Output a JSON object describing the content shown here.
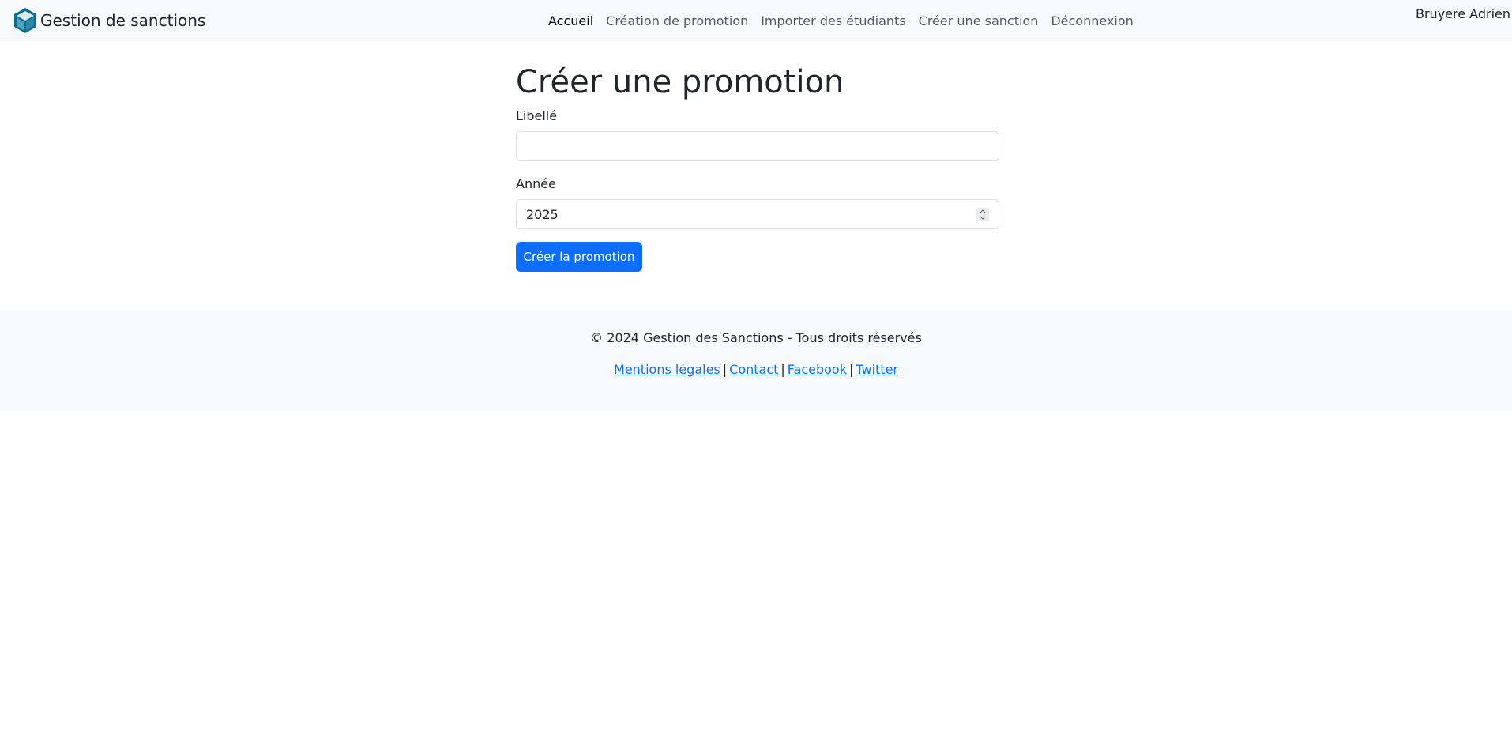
{
  "navbar": {
    "brand": "Gestion de sanctions",
    "links": [
      {
        "label": "Accueil",
        "active": true
      },
      {
        "label": "Création de promotion",
        "active": false
      },
      {
        "label": "Importer des étudiants",
        "active": false
      },
      {
        "label": "Créer une sanction",
        "active": false
      },
      {
        "label": "Déconnexion",
        "active": false
      }
    ],
    "user": "Bruyere Adrien"
  },
  "form": {
    "title": "Créer une promotion",
    "libelle_label": "Libellé",
    "libelle_value": "",
    "annee_label": "Année",
    "annee_value": "2025",
    "submit_label": "Créer la promotion"
  },
  "footer": {
    "copyright": "© 2024 Gestion des Sanctions - Tous droits réservés",
    "links": [
      "Mentions légales",
      "Contact",
      "Facebook",
      "Twitter"
    ],
    "separator": "|"
  },
  "colors": {
    "primary": "#0d6efd",
    "navbar_bg": "#f8f9fa",
    "logo": "#0b6e8e"
  }
}
